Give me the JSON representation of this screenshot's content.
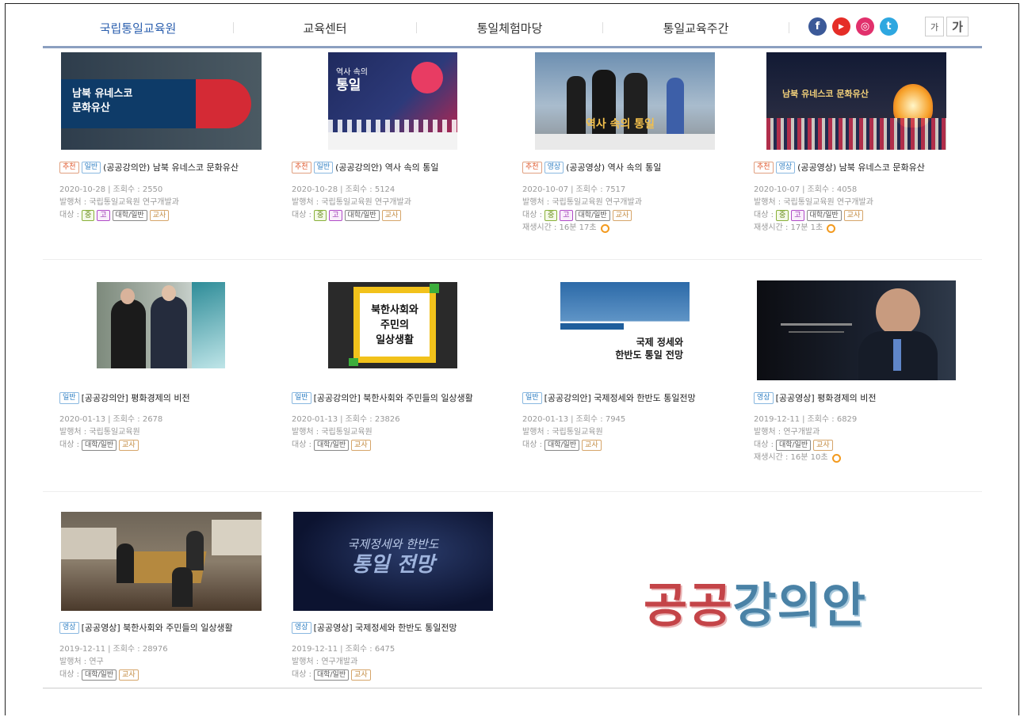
{
  "nav": {
    "items": [
      "국립통일교육원",
      "교육센터",
      "통일체험마당",
      "통일교육주간"
    ],
    "social": [
      {
        "icon": "facebook-icon",
        "glyph": "f"
      },
      {
        "icon": "youtube-icon",
        "glyph": "▶"
      },
      {
        "icon": "instagram-icon",
        "glyph": "◎"
      },
      {
        "icon": "twitter-icon",
        "glyph": "t"
      }
    ],
    "font_small": "가",
    "font_large": "가"
  },
  "labels": {
    "separator": "|",
    "audience_prefix": "대상 :"
  },
  "cards": [
    {
      "tags": [
        "추천",
        "일반"
      ],
      "title": "(공공강의안) 남북 유네스코 문화유산",
      "date": "2020-10-28",
      "views": "조회수 : 2550",
      "publisher": "발행처 : 국립통일교육원 연구개발과",
      "audience": [
        "중",
        "고",
        "대학/일반",
        "교사"
      ],
      "runtime": "",
      "thumb_text": [
        "남북 유네스코",
        "문화유산"
      ]
    },
    {
      "tags": [
        "추천",
        "일반"
      ],
      "title": "(공공강의안) 역사 속의 통일",
      "date": "2020-10-28",
      "views": "조회수 : 5124",
      "publisher": "발행처 : 국립통일교육원 연구개발과",
      "audience": [
        "중",
        "고",
        "대학/일반",
        "교사"
      ],
      "runtime": "",
      "thumb_text": [
        "역사 속의",
        "통일"
      ]
    },
    {
      "tags": [
        "추천",
        "영상"
      ],
      "title": "(공공영상) 역사 속의 통일",
      "date": "2020-10-07",
      "views": "조회수 : 7517",
      "publisher": "발행처 : 국립통일교육원 연구개발과",
      "audience": [
        "중",
        "고",
        "대학/일반",
        "교사"
      ],
      "runtime": "재생시간 : 16분 17초",
      "thumb_text": [
        "역사 속의 통일"
      ]
    },
    {
      "tags": [
        "추천",
        "영상"
      ],
      "title": "(공공영상) 남북 유네스코 문화유산",
      "date": "2020-10-07",
      "views": "조회수 : 4058",
      "publisher": "발행처 : 국립통일교육원 연구개발과",
      "audience": [
        "중",
        "고",
        "대학/일반",
        "교사"
      ],
      "runtime": "재생시간 : 17분 1초",
      "thumb_text": [
        "남북 유네스코 문화유산"
      ]
    },
    {
      "tags": [
        "일반"
      ],
      "title": "[공공강의안] 평화경제의 비전",
      "date": "2020-01-13",
      "views": "조회수 : 2678",
      "publisher": "발행처 : 국립통일교육원",
      "audience": [
        "대학/일반",
        "교사"
      ],
      "runtime": "",
      "thumb_text": []
    },
    {
      "tags": [
        "일반"
      ],
      "title": "[공공강의안] 북한사회와 주민들의 일상생활",
      "date": "2020-01-13",
      "views": "조회수 : 23826",
      "publisher": "발행처 : 국립통일교육원",
      "audience": [
        "대학/일반",
        "교사"
      ],
      "runtime": "",
      "thumb_text": [
        "북한사회와",
        "주민의",
        "일상생활"
      ]
    },
    {
      "tags": [
        "일반"
      ],
      "title": "[공공강의안] 국제정세와 한반도 통일전망",
      "date": "2020-01-13",
      "views": "조회수 : 7945",
      "publisher": "발행처 : 국립통일교육원",
      "audience": [
        "대학/일반",
        "교사"
      ],
      "runtime": "",
      "thumb_text": [
        "국제 정세와",
        "한반도 통일 전망"
      ]
    },
    {
      "tags": [
        "영상"
      ],
      "title": "[공공영상] 평화경제의 비전",
      "date": "2019-12-11",
      "views": "조회수 : 6829",
      "publisher": "발행처 : 연구개발과",
      "audience": [
        "대학/일반",
        "교사"
      ],
      "runtime": "재생시간 : 16분 10초",
      "thumb_text": []
    },
    {
      "tags": [
        "영상"
      ],
      "title": "[공공영상] 북한사회와 주민들의 일상생활",
      "date": "2019-12-11",
      "views": "조회수 : 28976",
      "publisher": "발행처 : 연구",
      "audience": [
        "대학/일반",
        "교사"
      ],
      "runtime": "",
      "thumb_text": []
    },
    {
      "tags": [
        "영상"
      ],
      "title": "[공공영상] 국제정세와 한반도 통일전망",
      "date": "2019-12-11",
      "views": "조회수 : 6475",
      "publisher": "발행처 : 연구개발과",
      "audience": [
        "대학/일반",
        "교사"
      ],
      "runtime": "",
      "thumb_text": [
        "국제정세와 한반도",
        "통일 전망"
      ]
    }
  ],
  "banner": {
    "part1": "공공",
    "part2": "강의안"
  },
  "colors": {
    "active_nav": "#2b5fae",
    "tag_recommend": "#e0562a",
    "tag_general": "#2f7fc3",
    "banner_red": "#c44448",
    "banner_blue": "#4a82a6"
  }
}
